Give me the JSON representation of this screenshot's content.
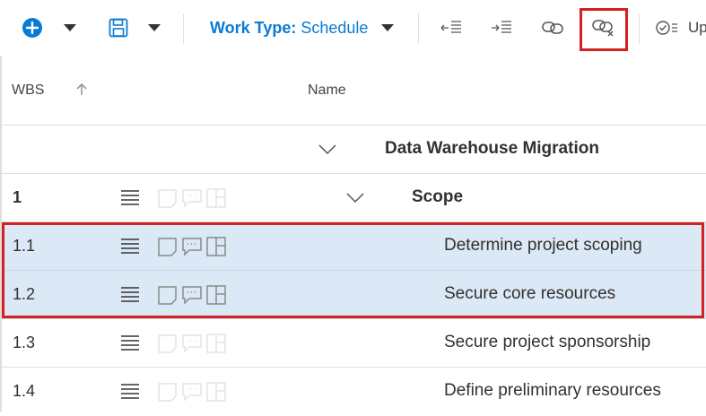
{
  "toolbar": {
    "worktype_label": "Work Type:",
    "worktype_value": "Schedule",
    "update_label": "Up",
    "icons": [
      "add-circle-icon",
      "chevron-down-icon",
      "save-icon",
      "chevron-down-icon",
      "outdent-icon",
      "indent-icon",
      "link-icon",
      "unlink-icon",
      "update-check-icon"
    ]
  },
  "header": {
    "wbs": "WBS",
    "name": "Name",
    "sort_icon": "arrow-up-icon"
  },
  "rows": [
    {
      "wbs": "",
      "name": "Data Warehouse Migration"
    },
    {
      "wbs": "1",
      "name": "Scope"
    },
    {
      "wbs": "1.1",
      "name": "Determine project scoping"
    },
    {
      "wbs": "1.2",
      "name": "Secure core resources"
    },
    {
      "wbs": "1.3",
      "name": "Secure project sponsorship"
    },
    {
      "wbs": "1.4",
      "name": "Define preliminary resources"
    }
  ],
  "colors": {
    "accent": "#0a7bd4",
    "highlight": "#d42020",
    "selected_row": "#dbe8f5"
  }
}
